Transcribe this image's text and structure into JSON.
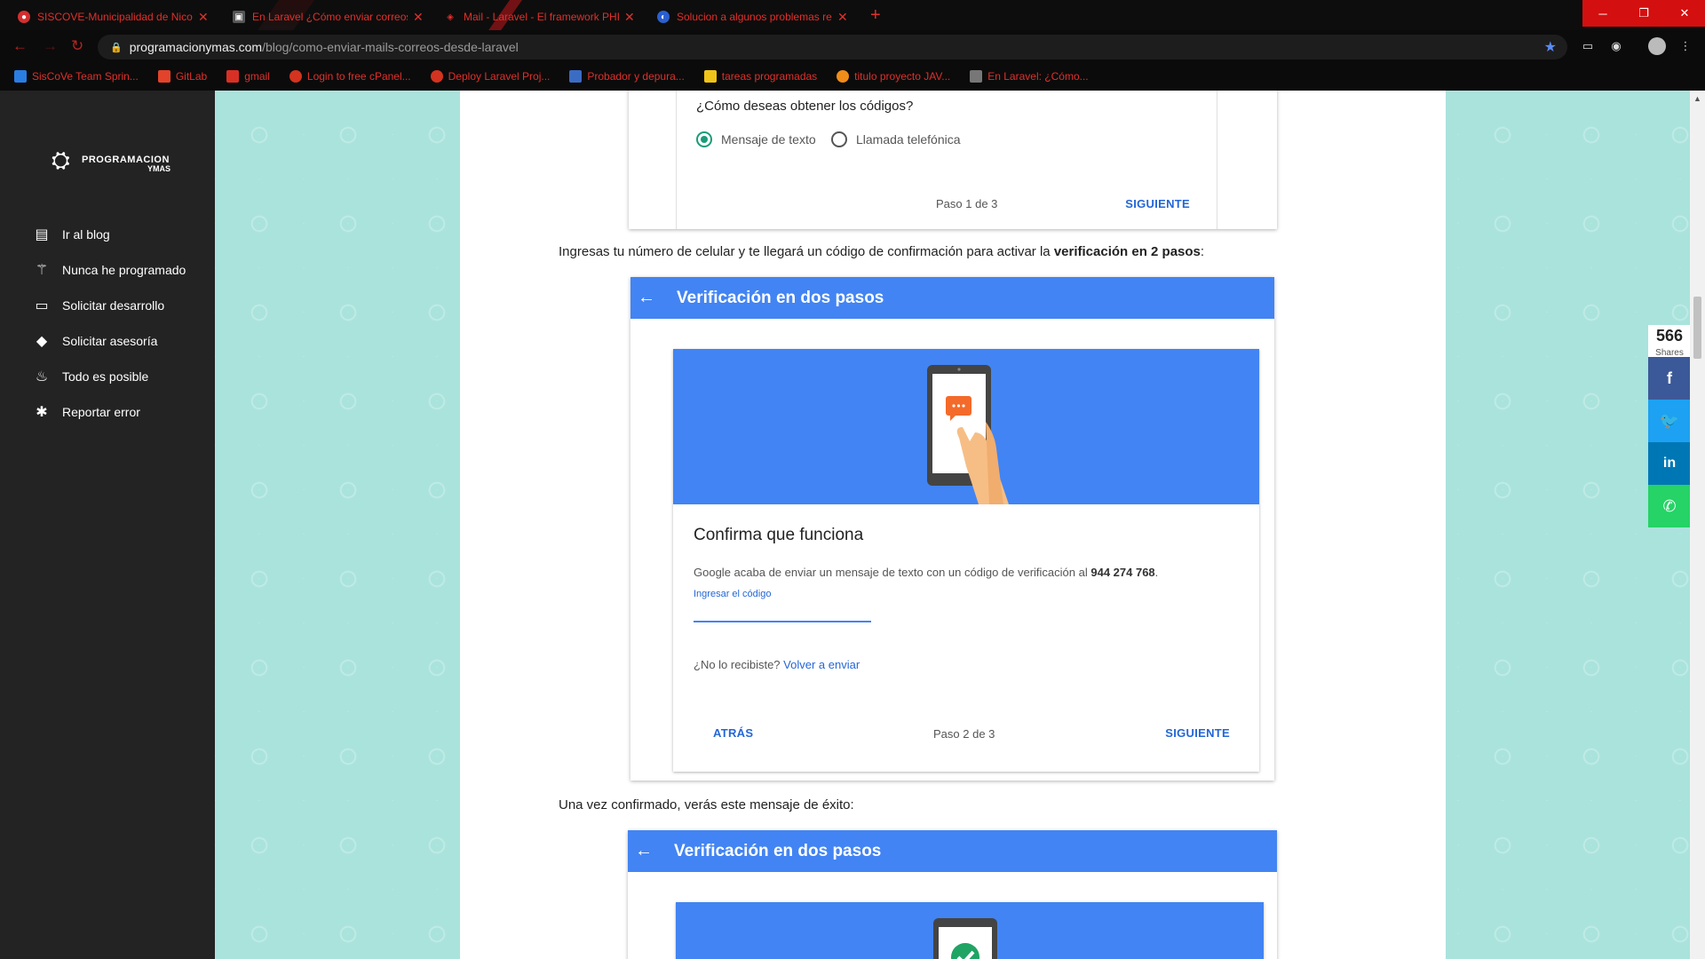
{
  "tabs": [
    {
      "title": "SISCOVE-Municipalidad de Nicolás",
      "favicon": "siscove-icon"
    },
    {
      "title": "En Laravel ¿Cómo enviar correos",
      "favicon": "page-icon"
    },
    {
      "title": "Mail - Laravel - El framework PHP",
      "favicon": "laravel-icon"
    },
    {
      "title": "Solucion a algunos problemas re",
      "favicon": "edge-icon"
    }
  ],
  "address": {
    "host": "programacionymas.com",
    "path": "/blog/como-enviar-mails-correos-desde-laravel"
  },
  "bookmarks": [
    {
      "label": "SisCoVe Team Sprin...",
      "color": "#2a7de1"
    },
    {
      "label": "GitLab",
      "color": "#e2432a"
    },
    {
      "label": "gmail",
      "color": "#d93025"
    },
    {
      "label": "Login to free cPanel...",
      "color": "#d4331f"
    },
    {
      "label": "Deploy Laravel Proj...",
      "color": "#d4331f"
    },
    {
      "label": "Probador y depura...",
      "color": "#3b6cc4"
    },
    {
      "label": "tareas programadas",
      "color": "#f0c419"
    },
    {
      "label": "titulo proyecto JAV...",
      "color": "#f08c19"
    },
    {
      "label": "En Laravel: ¿Cómo...",
      "color": "#777777"
    }
  ],
  "sidebar": {
    "logo_line1": "PROGRAMACION",
    "logo_line2": "YMAS",
    "items": [
      {
        "label": "Ir al blog",
        "icon": "book-icon"
      },
      {
        "label": "Nunca he programado",
        "icon": "magic-wand-icon"
      },
      {
        "label": "Solicitar desarrollo",
        "icon": "laptop-icon"
      },
      {
        "label": "Solicitar asesoría",
        "icon": "graduation-cap-icon"
      },
      {
        "label": "Todo es posible",
        "icon": "fire-icon"
      },
      {
        "label": "Reportar error",
        "icon": "bug-icon"
      }
    ]
  },
  "step1": {
    "question": "¿Cómo deseas obtener los códigos?",
    "option_sms": "Mensaje de texto",
    "option_call": "Llamada telefónica",
    "step": "Paso 1 de 3",
    "next": "SIGUIENTE"
  },
  "para1": {
    "text": "Ingresas tu número de celular y te llegará un código de confirmación para activar la ",
    "bold": "verificación en 2 pasos",
    "end": ":"
  },
  "card2": {
    "header": "Verificación en dos pasos",
    "heading": "Confirma que funciona",
    "body": "Google acaba de enviar un mensaje de texto con un código de verificación al ",
    "phone": "944 274 768",
    "body_end": ".",
    "code_label": "Ingresar el código",
    "not_received": "¿No lo recibiste?",
    "resend": "Volver a enviar",
    "back": "ATRÁS",
    "step": "Paso 2 de 3",
    "next": "SIGUIENTE"
  },
  "para2": "Una vez confirmado, verás este mensaje de éxito:",
  "card3": {
    "header": "Verificación en dos pasos"
  },
  "share": {
    "count": "566",
    "label": "Shares",
    "buttons": [
      {
        "icon": "facebook-icon",
        "color": "#3b5998",
        "glyph": "f"
      },
      {
        "icon": "twitter-icon",
        "color": "#1da1f2",
        "glyph": "t"
      },
      {
        "icon": "linkedin-icon",
        "color": "#0077b5",
        "glyph": "in"
      },
      {
        "icon": "whatsapp-icon",
        "color": "#25d366",
        "glyph": "w"
      }
    ]
  },
  "colors": {
    "accent_blue": "#4284f3",
    "link_blue": "#2467d6",
    "radio_green": "#1a9b7a",
    "sidebar_bg": "#232323",
    "pattern_bg": "#a9e3dc"
  }
}
